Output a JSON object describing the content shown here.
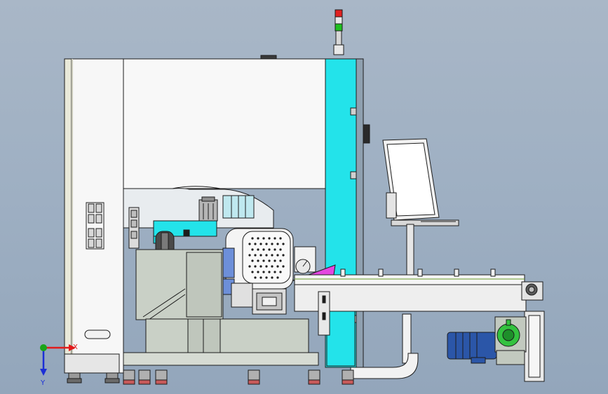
{
  "axes": {
    "x_label": "X",
    "y_label": "Y",
    "x_color": "#e21b1b",
    "y_color": "#1b2fd6",
    "origin_color": "#1aa51a"
  },
  "colors": {
    "background": "#9fb0c3",
    "machine_white": "#f7f7f7",
    "accent_cyan": "#23e3ea",
    "frame_gray": "#c9d0c6",
    "motor_blue": "#2b56a8",
    "gear_green": "#33c23f",
    "outline": "#1c1c1c"
  },
  "components": {
    "signal_tower": "signal-tower-icon",
    "monitor": "monitor-icon",
    "motor": "motor-icon",
    "conveyor": "conveyor-icon"
  }
}
